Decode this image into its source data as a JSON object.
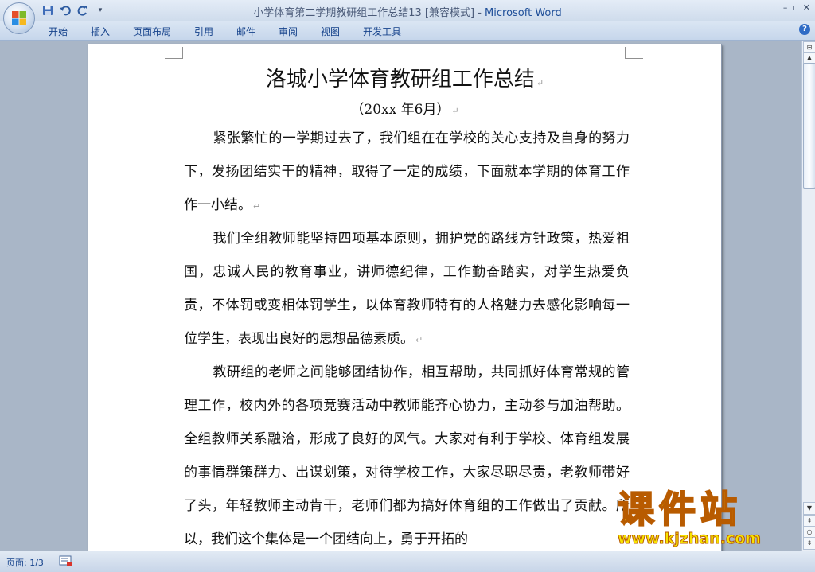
{
  "window": {
    "doc_name": "小学体育第二学期教研组工作总结13 [兼容模式]",
    "separator": " - ",
    "app_name": "Microsoft Word",
    "controls": [
      "–",
      "▫",
      "✕"
    ]
  },
  "quick_access": {
    "icons": [
      "save-icon",
      "undo-icon",
      "redo-icon",
      "customize-icon"
    ]
  },
  "ribbon": {
    "tabs": [
      "开始",
      "插入",
      "页面布局",
      "引用",
      "邮件",
      "审阅",
      "视图",
      "开发工具"
    ],
    "help": "?"
  },
  "document": {
    "title": "洛城小学体育教研组工作总结",
    "date": "（20xx 年6月）",
    "paragraphs": [
      "紧张繁忙的一学期过去了，我们组在在学校的关心支持及自身的努力下，发扬团结实干的精神，取得了一定的成绩，下面就本学期的体育工作作一小结。",
      "我们全组教师能坚持四项基本原则，拥护党的路线方针政策，热爱祖国，忠诚人民的教育事业，讲师德纪律，工作勤奋踏实，对学生热爱负责，不体罚或变相体罚学生，以体育教师特有的人格魅力去感化影响每一位学生，表现出良好的思想品德素质。",
      "教研组的老师之间能够团结协作，相互帮助，共同抓好体育常规的管理工作，校内外的各项竞赛活动中教师能齐心协力，主动参与加油帮助。全组教师关系融洽，形成了良好的风气。大家对有利于学校、体育组发展的事情群策群力、出谋划策，对待学校工作，大家尽职尽责，老教师带好了头，年轻教师主动肯干，老师们都为搞好体育组的工作做出了贡献。所以，我们这个集体是一个团结向上，勇于开拓的"
    ],
    "paragraph_mark": "↵"
  },
  "status_bar": {
    "page": "页面: 1/3"
  },
  "watermark": {
    "main": "课件站",
    "url": "www.kjzhan.com"
  },
  "colors": {
    "app_blue": "#1f4f99",
    "tab_text": "#15428b",
    "watermark_fill": "#f7e400",
    "watermark_stroke": "#b85b00"
  }
}
